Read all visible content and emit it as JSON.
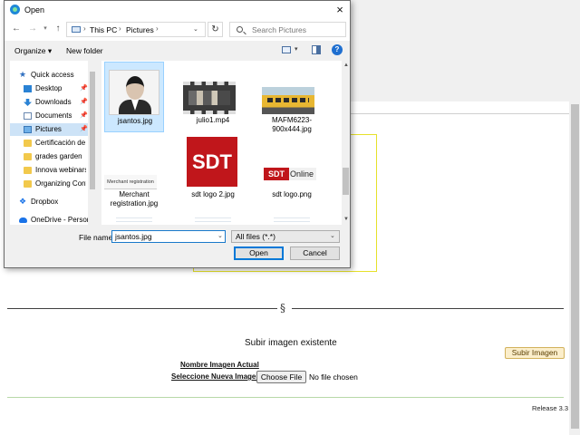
{
  "dialog": {
    "title": "Open",
    "close": "×",
    "address": {
      "root": "This PC",
      "folder": "Pictures"
    },
    "search_placeholder": "Search Pictures",
    "toolbar": {
      "organize": "Organize ▾",
      "new_folder": "New folder",
      "help": "?"
    },
    "nav_items": [
      {
        "label": "Quick access"
      },
      {
        "label": "Desktop"
      },
      {
        "label": "Downloads"
      },
      {
        "label": "Documents"
      },
      {
        "label": "Pictures"
      },
      {
        "label": "Certificación de"
      },
      {
        "label": "grades garden"
      },
      {
        "label": "Innova webinars"
      },
      {
        "label": "Organizing Cont"
      },
      {
        "label": "Dropbox"
      },
      {
        "label": "OneDrive - Persor"
      }
    ],
    "files": [
      {
        "name": "jsantos.jpg",
        "selected": true
      },
      {
        "name": "julio1.mp4"
      },
      {
        "name": "MAFM6223-900x444.jpg"
      },
      {
        "name": "Merchant registration.jpg",
        "thumb_text": "Merchant registration"
      },
      {
        "name": "sdt logo 2.jpg",
        "thumb_text": "SDT"
      },
      {
        "name": "sdt logo.png",
        "thumb_text_a": "SDT",
        "thumb_text_b": "Online"
      }
    ],
    "file_name_label": "File name:",
    "file_name_value": "jsantos.jpg",
    "file_type_value": "All files (*.*)",
    "open_label": "Open",
    "cancel_label": "Cancel"
  },
  "page": {
    "section_mark": "§",
    "subir_title": "Subir imagen existente",
    "subir_button": "Subir Imagen",
    "nombre_label": "Nombre Imagen Actual",
    "seleccione_label": "Seleccione Nueva Imagen",
    "choose_file": "Choose File",
    "no_file": "No file chosen",
    "release": "Release 3.3"
  },
  "colors": {
    "accent": "#0078d7",
    "selection": "#cce8ff",
    "sdt_red": "#c0161b",
    "subir_button": "#fbeecb"
  }
}
